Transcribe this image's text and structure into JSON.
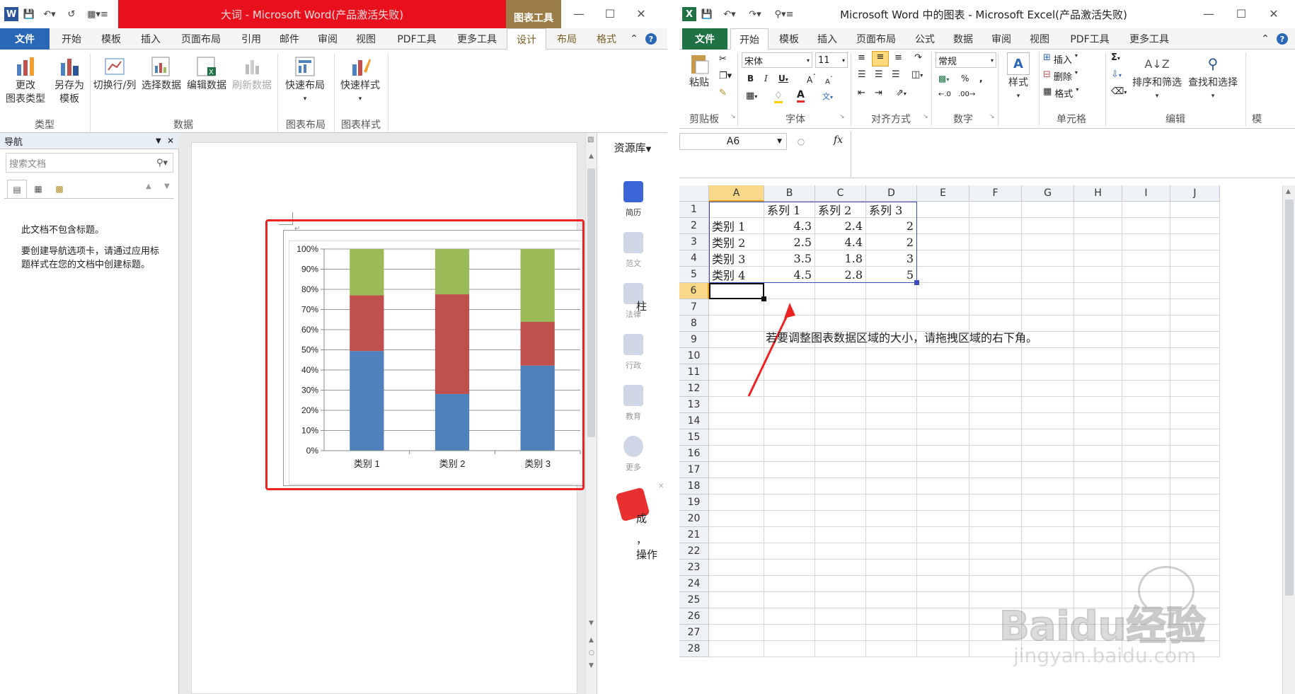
{
  "word": {
    "title": "大词 - Microsoft Word(产品激活失败)",
    "context_tab": "图表工具",
    "tabs": [
      "文件",
      "开始",
      "模板",
      "插入",
      "页面布局",
      "引用",
      "邮件",
      "审阅",
      "视图",
      "PDF工具",
      "更多工具",
      "设计",
      "布局",
      "格式"
    ],
    "ribbon": {
      "change_type": "更改\n图表类型",
      "save_template": "另存为\n模板",
      "switch": "切换行/列",
      "select_data": "选择数据",
      "edit_data": "编辑数据",
      "refresh_data": "刷新数据",
      "quick_layout": "快速布局",
      "quick_style": "快速样式",
      "grp_type": "类型",
      "grp_data": "数据",
      "grp_layout": "图表布局",
      "grp_style": "图表样式"
    },
    "nav": {
      "header": "导航",
      "search_placeholder": "搜索文档",
      "msg1": "此文档不包含标题。",
      "msg2": "要创建导航选项卡，请通过应用标题样式在您的文档中创建标题。"
    },
    "side": {
      "header": "资源库",
      "items": [
        "简历",
        "范文",
        "法律",
        "行政",
        "教育",
        "更多"
      ]
    },
    "doc_fragments": [
      "柱",
      "成",
      "，",
      "操作"
    ]
  },
  "chart_data": {
    "type": "bar",
    "stacked": "percent",
    "categories": [
      "类别 1",
      "类别 2",
      "类别 3"
    ],
    "series": [
      {
        "name": "系列 1",
        "values": [
          4.3,
          2.5,
          3.5
        ],
        "color": "#4f81bd"
      },
      {
        "name": "系列 2",
        "values": [
          2.4,
          4.4,
          1.8
        ],
        "color": "#c0504d"
      },
      {
        "name": "系列 3",
        "values": [
          2,
          2,
          3
        ],
        "color": "#9bbb59"
      }
    ],
    "ylim": [
      0,
      100
    ],
    "yticks": [
      "0%",
      "10%",
      "20%",
      "30%",
      "40%",
      "50%",
      "60%",
      "70%",
      "80%",
      "90%",
      "100%"
    ],
    "grid": true,
    "legend": "none"
  },
  "excel": {
    "title": "Microsoft Word 中的图表 - Microsoft Excel(产品激活失败)",
    "tabs": [
      "文件",
      "开始",
      "模板",
      "插入",
      "页面布局",
      "公式",
      "数据",
      "审阅",
      "视图",
      "PDF工具",
      "更多工具"
    ],
    "ribbon": {
      "paste": "粘贴",
      "font_name": "宋体",
      "font_size": "11",
      "number_format": "常规",
      "styles": "样式",
      "insert": "插入",
      "delete": "删除",
      "format": "格式",
      "sort_filter": "排序和筛选",
      "find_select": "查找和选择",
      "grp_clipboard": "剪贴板",
      "grp_font": "字体",
      "grp_align": "对齐方式",
      "grp_number": "数字",
      "grp_cells": "单元格",
      "grp_edit": "编辑",
      "grp_more": "模"
    },
    "name_box": "A6",
    "fx": "fx",
    "columns": [
      "A",
      "B",
      "C",
      "D",
      "E",
      "F",
      "G",
      "H",
      "I",
      "J"
    ],
    "rows": [
      "1",
      "2",
      "3",
      "4",
      "5",
      "6",
      "7",
      "8",
      "9",
      "10",
      "11",
      "12",
      "13",
      "14",
      "15",
      "16",
      "17",
      "18",
      "19",
      "20",
      "21",
      "22",
      "23",
      "24",
      "25",
      "26",
      "27",
      "28"
    ],
    "data": [
      [
        "",
        "系列 1",
        "系列 2",
        "系列 3"
      ],
      [
        "类别 1",
        "4.3",
        "2.4",
        "2"
      ],
      [
        "类别 2",
        "2.5",
        "4.4",
        "2"
      ],
      [
        "类别 3",
        "3.5",
        "1.8",
        "3"
      ],
      [
        "类别 4",
        "4.5",
        "2.8",
        "5"
      ]
    ],
    "note": "若要调整图表数据区域的大小，请拖拽区域的右下角。"
  },
  "watermark": {
    "text": "Baidu经验",
    "url": "jingyan.baidu.com"
  }
}
